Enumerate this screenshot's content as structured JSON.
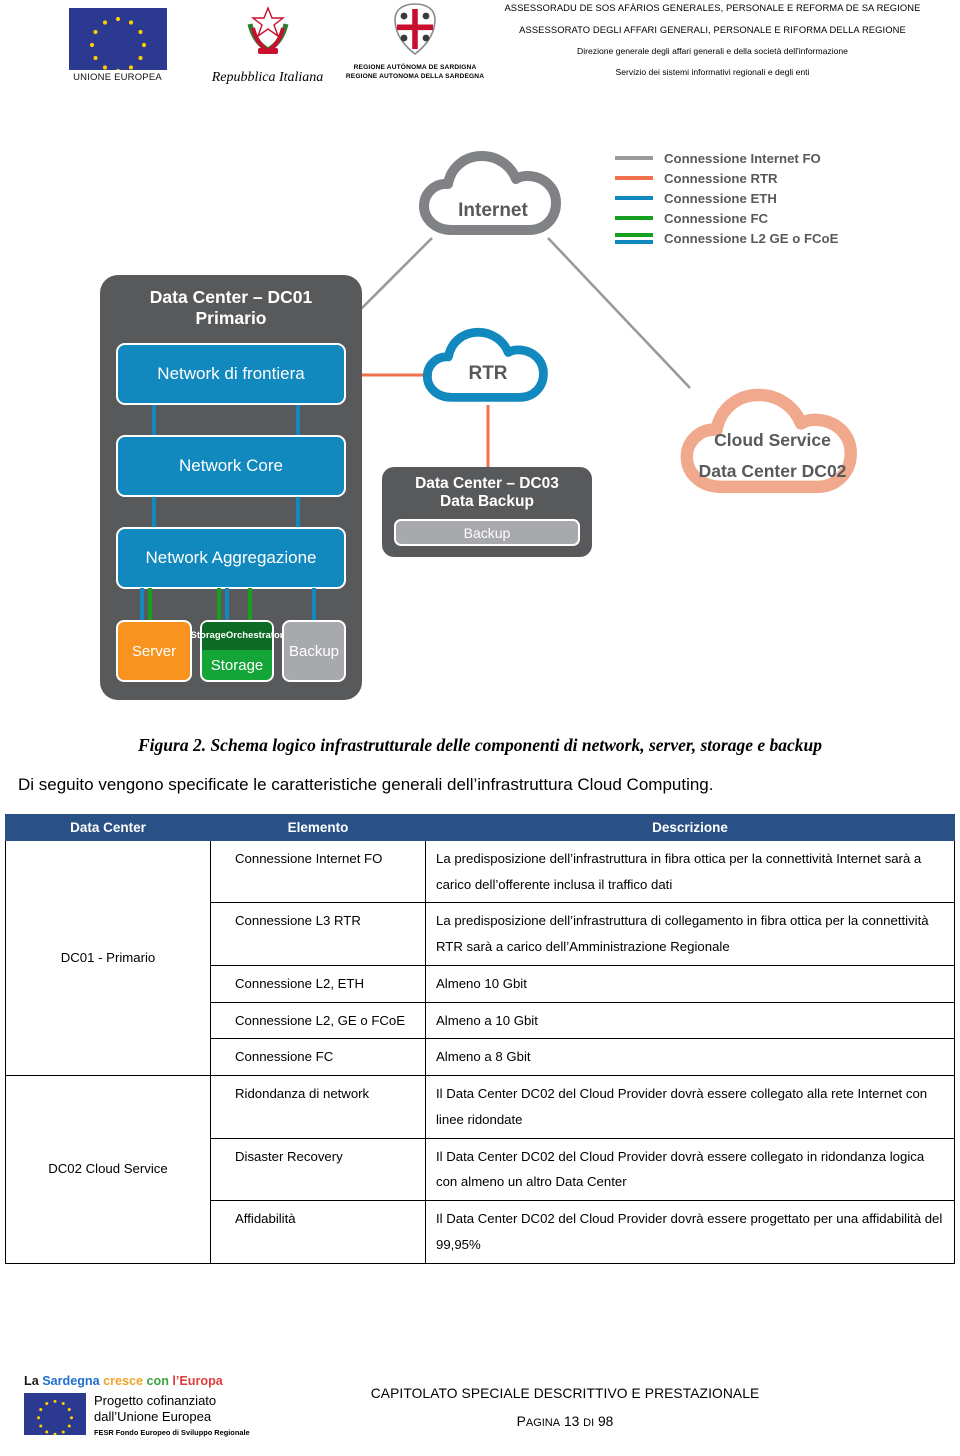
{
  "header": {
    "eu_logo_caption": "UNIONE EUROPEA",
    "italy_logo_caption": "Repubblica Italiana",
    "sardegna_caption_sc": "REGIONE AUTÒNOMA DE SARDIGNA",
    "sardegna_caption_it": "REGIONE AUTONOMA DELLA SARDEGNA",
    "line1": "ASSESSORADU DE SOS AFÀRIOS GENERALES, PERSONALE E REFORMA DE SA REGIONE",
    "line2": "ASSESSORATO DEGLI AFFARI GENERALI, PERSONALE E RIFORMA DELLA REGIONE",
    "line3": "Direzione generale degli affari generali e della società dell'informazione",
    "line4": "Servizio dei sistemi informativi regionali e degli enti"
  },
  "figure": {
    "caption": "Figura 2. Schema logico infrastrutturale delle componenti di network, server, storage e backup",
    "legend": [
      {
        "label": "Connessione Internet FO",
        "color": "#9A9A9A",
        "double": false
      },
      {
        "label": "Connessione RTR",
        "color": "#F0714B",
        "double": false
      },
      {
        "label": "Connessione ETH",
        "color": "#1188BE",
        "double": false
      },
      {
        "label": "Connessione FC",
        "color": "#17A020",
        "double": false
      },
      {
        "label": "Connessione L2 GE o FCoE",
        "color": "#17A020",
        "color2": "#1188BE",
        "double": true
      }
    ],
    "internet_cloud": "Internet",
    "rtr_cloud": "RTR",
    "cloud_service_line1": "Cloud Service",
    "cloud_service_line2": "Data Center DC02",
    "dc01": {
      "title_line1": "Data Center – DC01",
      "title_line2": "Primario",
      "boxes": [
        "Network di frontiera",
        "Network Core",
        "Network Aggregazione"
      ],
      "server": "Server",
      "storage_orchestrator_line1": "Storage",
      "storage_orchestrator_line2": "Orchestrator",
      "storage": "Storage",
      "backup": "Backup"
    },
    "dc03": {
      "title_line1": "Data Center – DC03",
      "title_line2": "Data Backup",
      "backup": "Backup"
    },
    "colors": {
      "container_gray": "#58595B",
      "network_blue": "#1188BE",
      "server_orange": "#F7931E",
      "storage_green": "#13A538",
      "orchestrator_green": "#0C6B24",
      "backup_gray": "#A7A9AC",
      "internet_gray": "#808285",
      "rtr_blue": "#1188BE",
      "cloud_salmon": "#F0A98C"
    }
  },
  "body": {
    "paragraph": "Di seguito vengono specificate le caratteristiche generali dell’infrastruttura Cloud Computing."
  },
  "table": {
    "headers": [
      "Data Center",
      "Elemento",
      "Descrizione"
    ],
    "header_bg": "#2A5186",
    "groups": [
      {
        "data_center": "DC01 - Primario",
        "rows": [
          {
            "elemento": "Connessione Internet FO",
            "descrizione": "La predisposizione dell’infrastruttura in fibra ottica per la connettività Internet sarà a carico dell’offerente inclusa il traffico dati"
          },
          {
            "elemento": "Connessione L3 RTR",
            "descrizione": "La predisposizione dell’infrastruttura di collegamento in fibra ottica per la connettività RTR sarà a carico dell’Amministrazione Regionale"
          },
          {
            "elemento": "Connessione L2, ETH",
            "descrizione": "Almeno 10 Gbit"
          },
          {
            "elemento": "Connessione L2, GE o FCoE",
            "descrizione": "Almeno a 10 Gbit"
          },
          {
            "elemento": "Connessione FC",
            "descrizione": "Almeno a 8 Gbit"
          }
        ]
      },
      {
        "data_center": "DC02 Cloud Service",
        "rows": [
          {
            "elemento": "Ridondanza di network",
            "descrizione": "Il Data Center DC02 del Cloud Provider dovrà essere collegato alla rete Internet con linee ridondate"
          },
          {
            "elemento": "Disaster Recovery",
            "descrizione": "Il Data Center DC02 del Cloud Provider dovrà essere collegato in ridondanza logica con almeno un altro Data Center"
          },
          {
            "elemento": "Affidabilità",
            "descrizione": "Il Data Center DC02 del Cloud Provider dovrà essere progettato per una affidabilità del 99,95%"
          }
        ]
      }
    ]
  },
  "footer": {
    "tag_w1": "La ",
    "tag_w2": "Sardegna ",
    "tag_w3": "cresce ",
    "tag_w4": "con ",
    "tag_w5": "l’Europa",
    "logo_line1": "Progetto cofinanziato",
    "logo_line2": "dall’Unione Europea",
    "logo_line3": "FESR Fondo Europeo di Sviluppo Regionale",
    "doc_title": "CAPITOLATO SPECIALE DESCRITTIVO E PRESTAZIONALE",
    "page_label": "P",
    "page_label_rest": "AGINA",
    "page_number": "13",
    "page_of": "DI",
    "page_total": "98"
  }
}
